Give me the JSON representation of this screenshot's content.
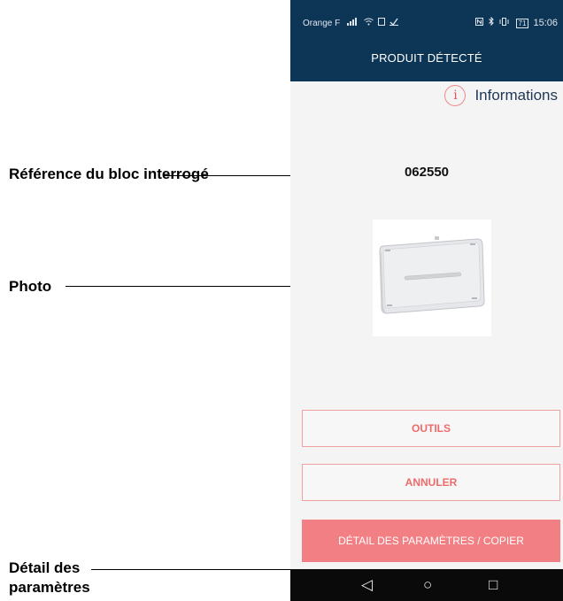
{
  "annotations": {
    "reference_label": "Référence du bloc interrogé",
    "photo_label": "Photo",
    "params_label": "Détail des paramètres"
  },
  "status_bar": {
    "carrier": "Orange F",
    "battery": "71",
    "time": "15:06"
  },
  "app_bar": {
    "title": "PRODUIT DÉTECTÉ"
  },
  "info": {
    "icon_glyph": "i",
    "label": "Informations"
  },
  "product": {
    "reference": "062550",
    "photo_icon": "emergency-light-block-image"
  },
  "buttons": {
    "tools": "OUTILS",
    "cancel": "ANNULER",
    "params": "DÉTAIL DES PARAMÈTRES / COPIER"
  },
  "nav": {
    "back": "◁",
    "home": "○",
    "recents": "□"
  },
  "colors": {
    "app_bar": "#0d3556",
    "accent": "#f17f83",
    "button_text": "#ee6b6b",
    "button_border": "#f0a0a0"
  }
}
